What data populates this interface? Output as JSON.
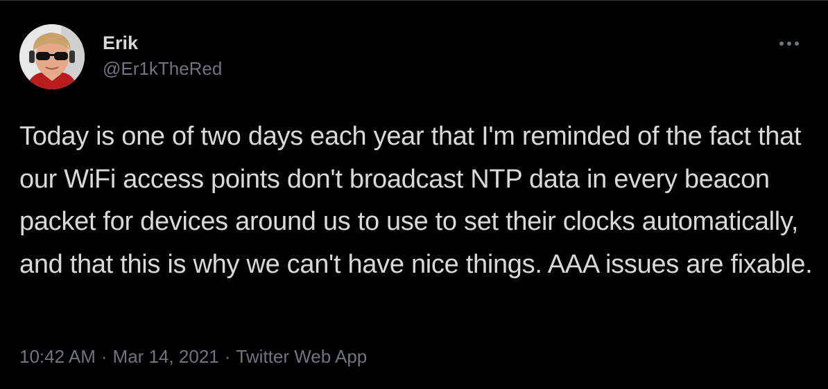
{
  "tweet": {
    "author": {
      "display_name": "Erik",
      "handle": "@Er1kTheRed"
    },
    "text": "Today is one of two days each year that I'm reminded of the fact that our WiFi access points don't broadcast NTP data in every beacon packet for devices around us to use to set their clocks automatically, and that this is why we can't have nice things. AAA issues are fixable.",
    "time": "10:42 AM",
    "date": "Mar 14, 2021",
    "separator": "·",
    "source": "Twitter Web App",
    "more_icon": "more-horizontal-icon"
  },
  "colors": {
    "background": "#000000",
    "primary_text": "#d9d9d9",
    "secondary_text": "#6e767d",
    "border": "#2f3336"
  }
}
